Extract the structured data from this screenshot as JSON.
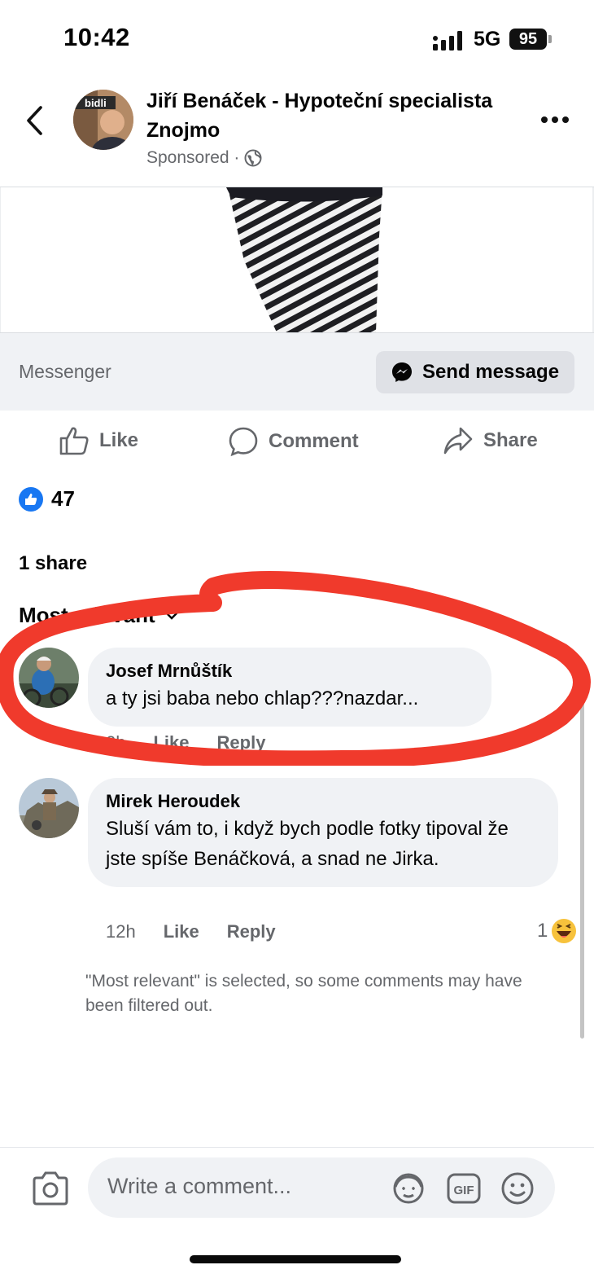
{
  "status_bar": {
    "time": "10:42",
    "network": "5G",
    "battery": "95"
  },
  "header": {
    "page_name": "Jiří Benáček - Hypoteční specialista Znojmo",
    "sponsored": "Sponsored ·",
    "avatar_sign_text": "bidli"
  },
  "cta": {
    "label": "Messenger",
    "button": "Send message"
  },
  "actions": {
    "like": "Like",
    "comment": "Comment",
    "share": "Share"
  },
  "reactions": {
    "count": "47"
  },
  "shares": "1 share",
  "sort": {
    "label": "Most relevant"
  },
  "comments": [
    {
      "author": "Josef Mrnůštík",
      "text": "a ty jsi baba nebo chlap???nazdar...",
      "time": "2h",
      "like": "Like",
      "reply": "Reply"
    },
    {
      "author": "Mirek Heroudek",
      "text": "Sluší vám to, i když bych podle fotky tipoval že jste spíše Benáčková, a snad ne Jirka.",
      "time": "12h",
      "like": "Like",
      "reply": "Reply",
      "reaction_count": "1",
      "reaction_icon": "laughing-emoji-icon"
    }
  ],
  "filter_note": "\"Most relevant\" is selected, so some comments may have been filtered out.",
  "composer": {
    "placeholder": "Write a comment..."
  },
  "colors": {
    "brand_blue": "#1877f2",
    "annotation_red": "#f03a2c",
    "bubble": "#f0f2f5",
    "secondary_text": "#65676b"
  }
}
